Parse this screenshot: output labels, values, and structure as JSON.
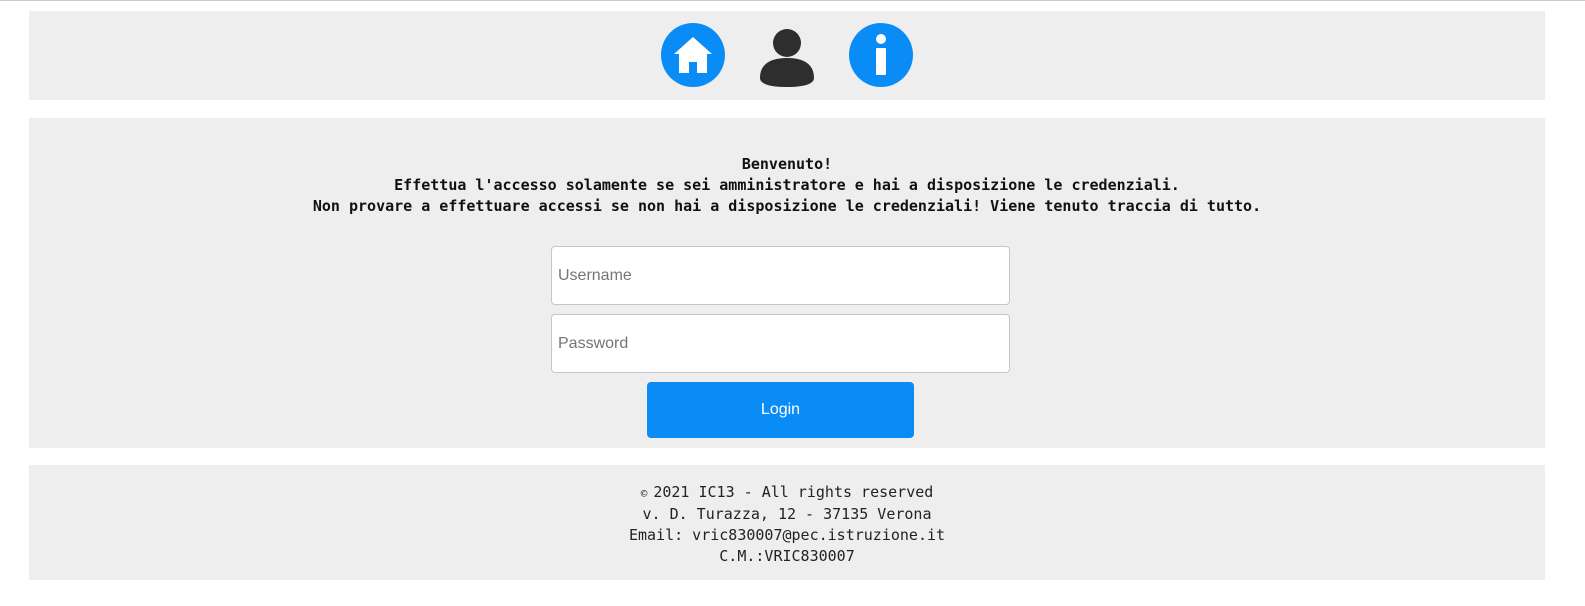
{
  "nav": {
    "icons": [
      "home-icon",
      "user-icon",
      "info-icon"
    ],
    "colors": {
      "accent": "#0a8cf7",
      "user": "#2e2e2e",
      "panel": "#eeeeee"
    }
  },
  "welcome": {
    "line1": "Benvenuto!",
    "line2": "Effettua l'accesso solamente se sei amministratore e hai a disposizione le credenziali.",
    "line3": "Non provare a effettuare accessi se non hai a disposizione le credenziali! Viene tenuto traccia di tutto."
  },
  "login_form": {
    "username_placeholder": "Username",
    "username_value": "",
    "password_placeholder": "Password",
    "password_value": "",
    "submit_label": "Login"
  },
  "footer": {
    "copyright_symbol": "©",
    "copyright_text": "2021 IC13 - All rights reserved",
    "address": "v. D. Turazza, 12 - 37135 Verona",
    "email": "Email: vric830007@pec.istruzione.it",
    "code": "C.M.:VRIC830007"
  }
}
